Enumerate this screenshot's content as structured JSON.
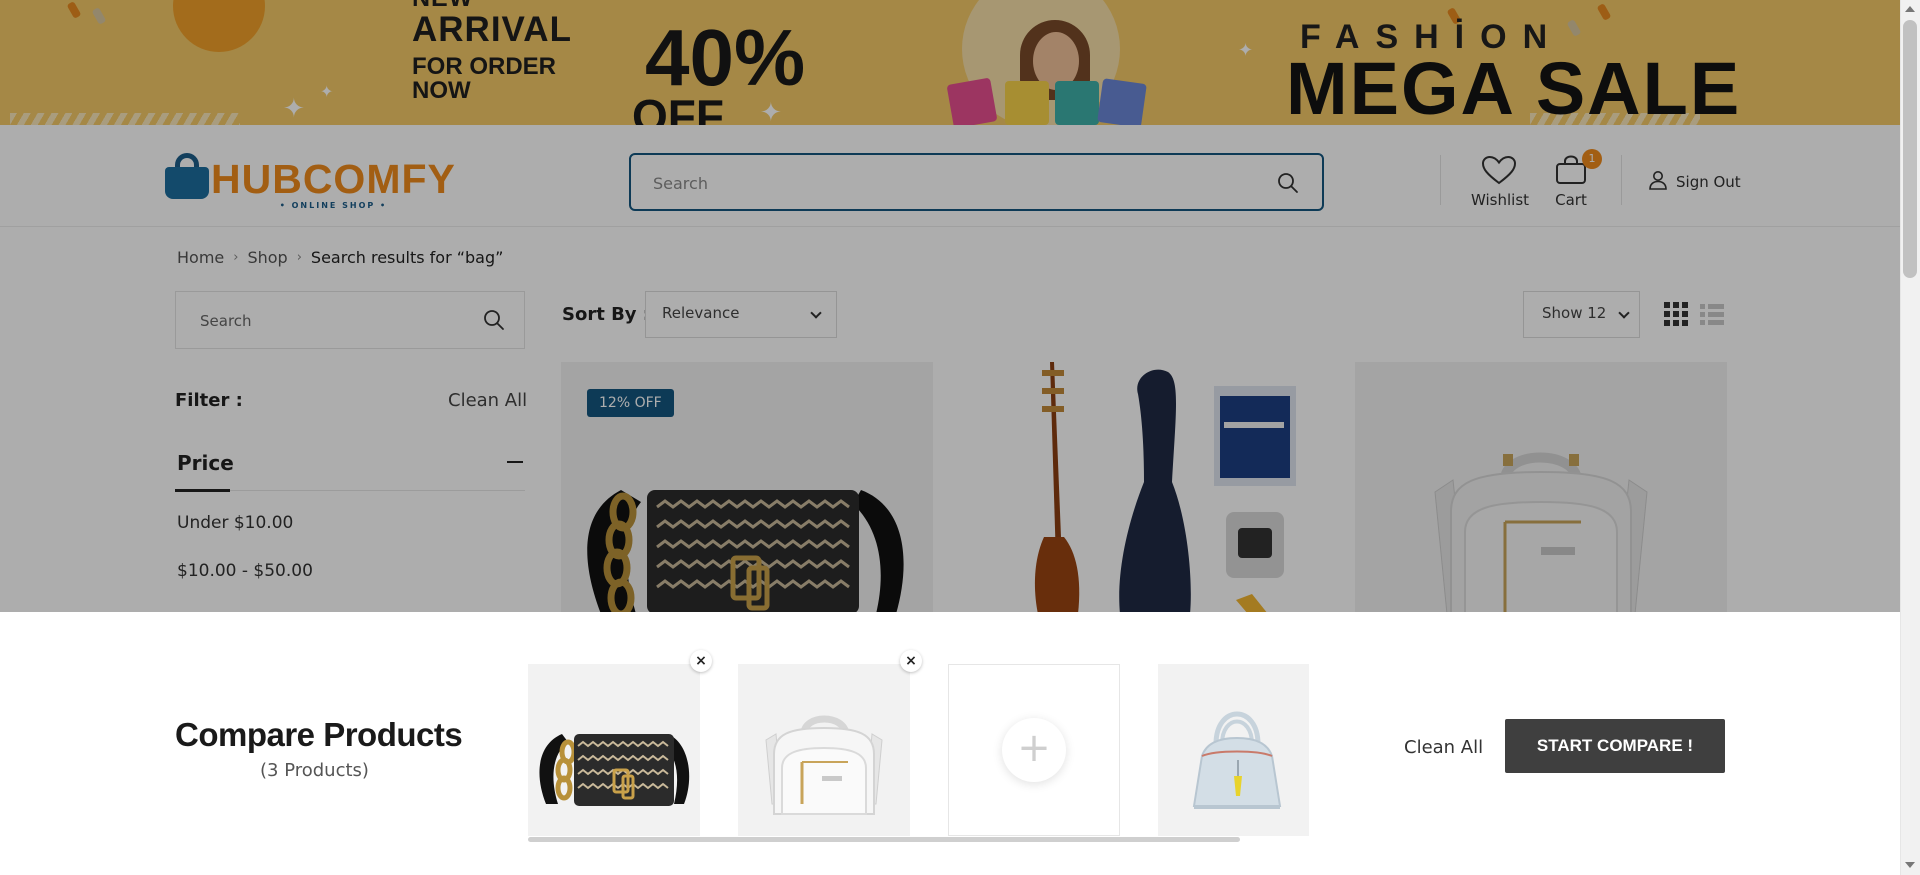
{
  "banner": {
    "arrival_line1": "NEW",
    "arrival_line2": "ARRIVAL",
    "arrival_line3": "FOR ORDER",
    "arrival_line4": "NOW",
    "discount": "40%",
    "discount_suffix": "OFF",
    "headline_top": "FASHİON",
    "headline_main": "MEGA SALE",
    "bg_color": "#f4c967"
  },
  "header": {
    "logo_name": "HUBCOMFY",
    "logo_tagline": "• ONLINE SHOP •",
    "search_placeholder": "Search",
    "wishlist_label": "Wishlist",
    "cart_label": "Cart",
    "cart_count": "1",
    "signout_label": "Sign Out",
    "brand_color": "#ef8b1c",
    "accent_color": "#14567f"
  },
  "breadcrumb": {
    "home": "Home",
    "shop": "Shop",
    "current": "Search results for “bag”"
  },
  "sidebar": {
    "search_placeholder": "Search",
    "filter_label": "Filter :",
    "clear_all": "Clean All",
    "price_heading": "Price",
    "price_options": [
      "Under $10.00",
      "$10.00 - $50.00"
    ]
  },
  "toolbar": {
    "sort_label": "Sort By :",
    "sort_value": "Relevance",
    "show_value": "Show 12",
    "grid_icon": "grid-icon",
    "list_icon": "list-icon"
  },
  "products": [
    {
      "badge": "12% OFF",
      "image": "black-chain-bag"
    },
    {
      "image": "instrument-bundle"
    },
    {
      "image": "white-backpack"
    }
  ],
  "compare": {
    "title": "Compare Products",
    "count": "(3 Products)",
    "slots": [
      "black-chain-bag",
      "white-backpack",
      "empty",
      "light-blue-handbag"
    ],
    "clear_label": "Clean All",
    "start_label": "START COMPARE !"
  }
}
